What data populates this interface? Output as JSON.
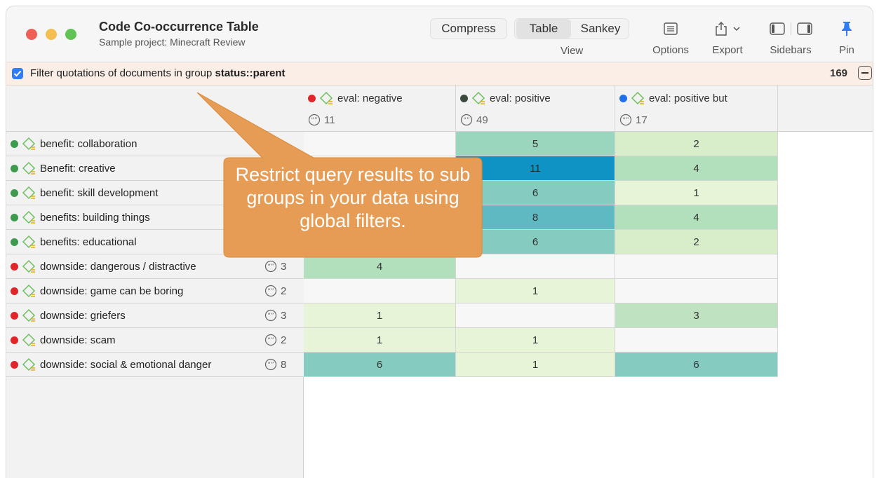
{
  "window": {
    "title": "Code Co-occurrence Table",
    "subtitle": "Sample project: Minecraft Review"
  },
  "toolbar": {
    "compress_label": "Compress",
    "view_options": [
      "Table",
      "Sankey"
    ],
    "view_selected": "Table",
    "view_label": "View",
    "options_label": "Options",
    "export_label": "Export",
    "sidebars_label": "Sidebars",
    "pin_label": "Pin",
    "icons": [
      "options-icon",
      "export-icon",
      "sidebar-left-icon",
      "sidebar-right-icon",
      "pin-icon"
    ]
  },
  "filter": {
    "checked": true,
    "text": "Filter quotations of documents in group ",
    "group": "status::parent",
    "count": "169"
  },
  "columns": [
    {
      "name": "eval: negative",
      "count": "11",
      "color": "#e0262b"
    },
    {
      "name": "eval: positive",
      "count": "49",
      "color": "#3b4a3d"
    },
    {
      "name": "eval: positive but",
      "count": "17",
      "color": "#1f6fe8"
    }
  ],
  "rows": [
    {
      "name": "benefit: collaboration",
      "color": "#3e9a4e",
      "count": "",
      "values": [
        "",
        "5",
        "2"
      ]
    },
    {
      "name": "Benefit: creative",
      "color": "#3e9a4e",
      "count": "",
      "values": [
        "",
        "11",
        "4"
      ]
    },
    {
      "name": "benefit: skill development",
      "color": "#3e9a4e",
      "count": "",
      "values": [
        "",
        "6",
        "1"
      ]
    },
    {
      "name": "benefits: building things",
      "color": "#3e9a4e",
      "count": "",
      "values": [
        "",
        "8",
        "4"
      ]
    },
    {
      "name": "benefits: educational",
      "color": "#3e9a4e",
      "count": "",
      "values": [
        "",
        "6",
        "2"
      ]
    },
    {
      "name": "downside: dangerous / distractive",
      "color": "#e0262b",
      "count": "3",
      "values": [
        "4",
        "",
        ""
      ]
    },
    {
      "name": "downside: game can be boring",
      "color": "#e0262b",
      "count": "2",
      "values": [
        "",
        "1",
        ""
      ]
    },
    {
      "name": "downside: griefers",
      "color": "#e0262b",
      "count": "3",
      "values": [
        "1",
        "",
        "3"
      ]
    },
    {
      "name": "downside: scam",
      "color": "#e0262b",
      "count": "2",
      "values": [
        "1",
        "1",
        ""
      ]
    },
    {
      "name": "downside: social & emotional danger",
      "color": "#e0262b",
      "count": "8",
      "values": [
        "6",
        "1",
        "6"
      ]
    }
  ],
  "heat_colors": {
    "empty": "#f7f7f7",
    "1": "#e8f4d8",
    "2": "#d8eecb",
    "3": "#bfe2c0",
    "4": "#b2dfbc",
    "5": "#9ad6bd",
    "6": "#86cbc0",
    "8": "#5fb9c3",
    "11": "#0e93c4"
  },
  "callout": {
    "text": "Restrict query results to sub groups in your data using global filters.",
    "color": "#e79c55"
  }
}
